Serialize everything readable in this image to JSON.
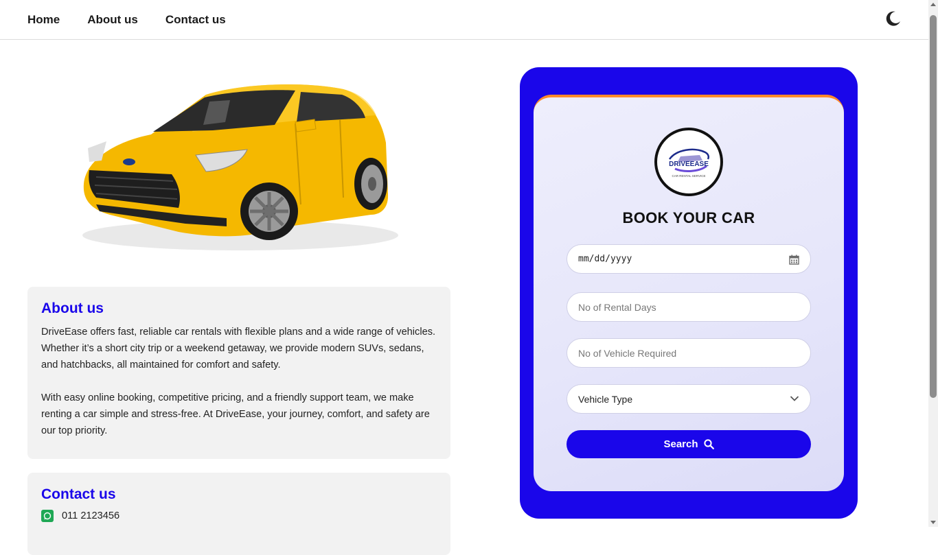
{
  "nav": {
    "links": [
      "Home",
      "About us",
      "Contact us"
    ],
    "theme_icon": "moon-icon"
  },
  "hero": {
    "image": "yellow hatchback car",
    "image_colors": {
      "body": "#f5b800",
      "glass": "#2b2b2b",
      "wheel": "#9a9a9a"
    }
  },
  "about": {
    "title": "About us",
    "paragraphs": [
      "DriveEase offers fast, reliable car rentals with flexible plans and a wide range of vehicles. Whether it’s a short city trip or a weekend getaway, we provide modern SUVs, sedans, and hatchbacks, all maintained for comfort and safety.",
      "With easy online booking, competitive pricing, and a friendly support team, we make renting a car simple and stress-free. At DriveEase, your journey, comfort, and safety are our top priority."
    ]
  },
  "contact": {
    "title": "Contact us",
    "phone": "011 2123456",
    "phone_icon": "whatsapp-icon"
  },
  "booking": {
    "logo_text": "DRIVEEASE",
    "logo_subtext": "CAR RENTAL SERVICE",
    "title": "BOOK YOUR CAR",
    "date_placeholder": "mm/dd/yyyy",
    "days_placeholder": "No of Rental Days",
    "vehicles_placeholder": "No of Vehicle Required",
    "vehicle_type": "Vehicle Type",
    "search_label": "Search",
    "colors": {
      "accent": "#1a06ea",
      "top_stripe": "#ff8a2b"
    }
  }
}
